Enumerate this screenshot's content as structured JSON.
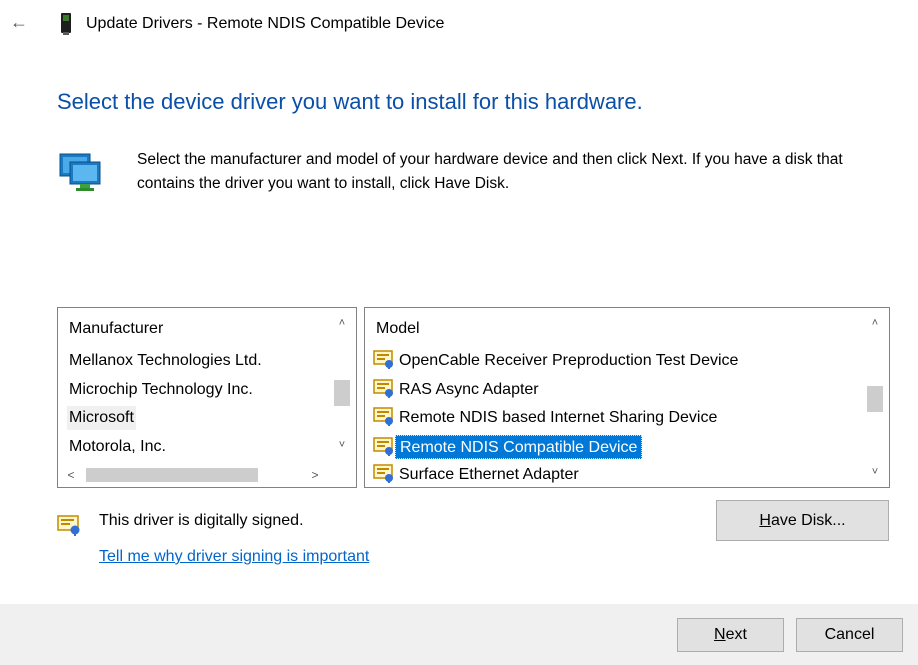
{
  "window": {
    "title": "Update Drivers - Remote NDIS Compatible Device",
    "back_glyph": "←"
  },
  "heading": "Select the device driver you want to install for this hardware.",
  "instructions": "Select the manufacturer and model of your hardware device and then click Next. If you have a disk that contains the driver you want to install, click Have Disk.",
  "manufacturer_list": {
    "header": "Manufacturer",
    "items": [
      {
        "label": "Mellanox Technologies Ltd.",
        "selected": false
      },
      {
        "label": "Microchip Technology Inc.",
        "selected": false
      },
      {
        "label": "Microsoft",
        "selected": true
      },
      {
        "label": "Motorola, Inc.",
        "selected": false
      }
    ],
    "scroll_up": "˄",
    "scroll_down": "˅",
    "scroll_left": "<",
    "scroll_right": ">"
  },
  "model_list": {
    "header": "Model",
    "items": [
      {
        "label": "OpenCable Receiver Preproduction Test Device",
        "selected": false
      },
      {
        "label": "RAS Async Adapter",
        "selected": false
      },
      {
        "label": "Remote NDIS based Internet Sharing Device",
        "selected": false
      },
      {
        "label": "Remote NDIS Compatible Device",
        "selected": true
      },
      {
        "label": "Surface Ethernet Adapter",
        "selected": false
      }
    ],
    "item_icon": "driver-certificate-icon",
    "scroll_up": "˄",
    "scroll_down": "˅"
  },
  "signing": {
    "status": "This driver is digitally signed.",
    "link": "Tell me why driver signing is important",
    "icon": "signed-certificate-icon"
  },
  "buttons": {
    "have_disk_mnemonic": "H",
    "have_disk_rest": "ave Disk...",
    "next_mnemonic": "N",
    "next_rest": "ext",
    "cancel": "Cancel"
  },
  "colors": {
    "heading": "#0a4fa8",
    "link": "#0066cc",
    "selection": "#0078d7",
    "footer_bg": "#f0f0f0"
  }
}
